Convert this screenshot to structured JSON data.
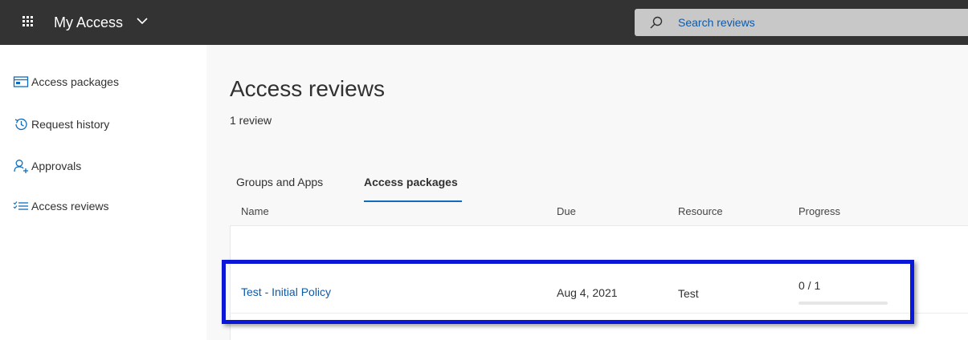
{
  "header": {
    "app_title": "My Access",
    "search_placeholder": "Search reviews"
  },
  "sidebar": {
    "items": [
      {
        "label": "Access packages",
        "icon": "access-packages-icon"
      },
      {
        "label": "Request history",
        "icon": "history-icon"
      },
      {
        "label": "Approvals",
        "icon": "approvals-icon"
      },
      {
        "label": "Access reviews",
        "icon": "access-reviews-icon"
      }
    ]
  },
  "main": {
    "title": "Access reviews",
    "review_count": "1 review",
    "tabs": [
      {
        "label": "Groups and Apps",
        "selected": false
      },
      {
        "label": "Access packages",
        "selected": true
      }
    ],
    "table": {
      "columns": [
        "Name",
        "Due",
        "Resource",
        "Progress"
      ],
      "rows": [
        {
          "name": "Test - Initial Policy",
          "due": "Aug 4, 2021",
          "resource": "Test",
          "progress": "0 / 1",
          "progress_fraction": 0
        }
      ]
    }
  },
  "colors": {
    "topbar": "#333333",
    "link": "#0f5aa8",
    "accent": "#0f6cbd",
    "highlight": "#0a16d8"
  }
}
